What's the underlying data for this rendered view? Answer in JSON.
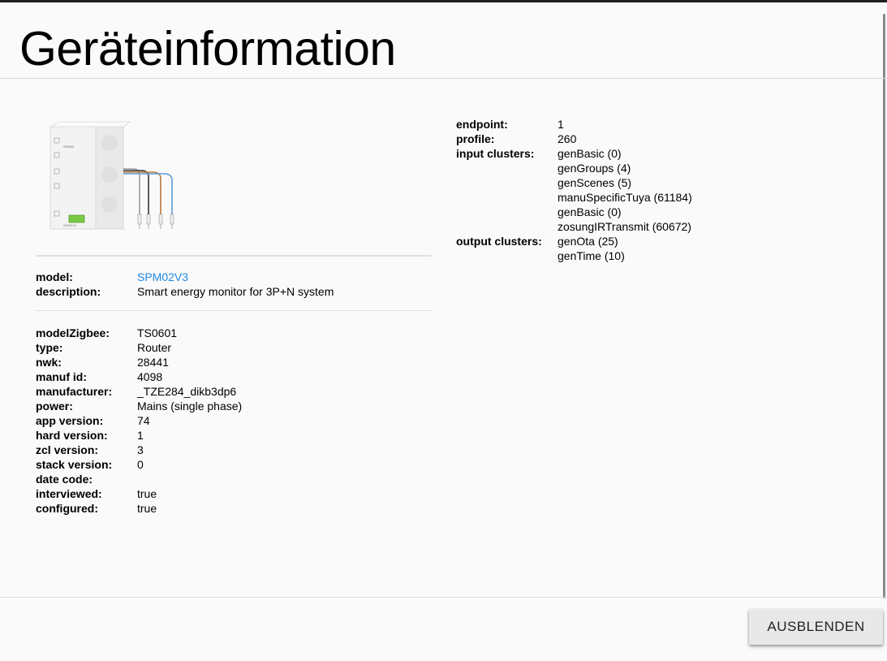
{
  "dialog": {
    "title": "Geräteinformation"
  },
  "device": {
    "model_label": "model:",
    "model_value": "SPM02V3",
    "description_label": "description:",
    "description_value": "Smart energy monitor for 3P+N system"
  },
  "details": [
    {
      "key": "modelZigbee:",
      "value": "TS0601"
    },
    {
      "key": "type:",
      "value": "Router"
    },
    {
      "key": "nwk:",
      "value": "28441"
    },
    {
      "key": "manuf id:",
      "value": "4098"
    },
    {
      "key": "manufacturer:",
      "value": "_TZE284_dikb3dp6"
    },
    {
      "key": "power:",
      "value": "Mains (single phase)"
    },
    {
      "key": "app version:",
      "value": "74"
    },
    {
      "key": "hard version:",
      "value": "1"
    },
    {
      "key": "zcl version:",
      "value": "3"
    },
    {
      "key": "stack version:",
      "value": "0"
    },
    {
      "key": "date code:",
      "value": ""
    },
    {
      "key": "interviewed:",
      "value": "true"
    },
    {
      "key": "configured:",
      "value": "true"
    }
  ],
  "endpoint": {
    "endpoint_label": "endpoint:",
    "endpoint_value": "1",
    "profile_label": "profile:",
    "profile_value": "260",
    "input_label": "input clusters:",
    "input_clusters": [
      "genBasic (0)",
      "genGroups (4)",
      "genScenes (5)",
      "manuSpecificTuya (61184)",
      "genBasic (0)",
      "zosungIRTransmit (60672)"
    ],
    "output_label": "output clusters:",
    "output_clusters": [
      "genOta (25)",
      "genTime (10)"
    ]
  },
  "footer": {
    "hide_button": "AUSBLENDEN"
  },
  "device_image": {
    "model_print": "SPM02",
    "footer_print": "SPM02V3"
  },
  "colors": {
    "link": "#1e88e5",
    "background": "#fafafa",
    "wire_black": "#333333",
    "wire_brown": "#b8793a",
    "wire_blue": "#5a9bd8",
    "wire_gray": "#9a9a9a",
    "display_green": "#7ac943"
  }
}
